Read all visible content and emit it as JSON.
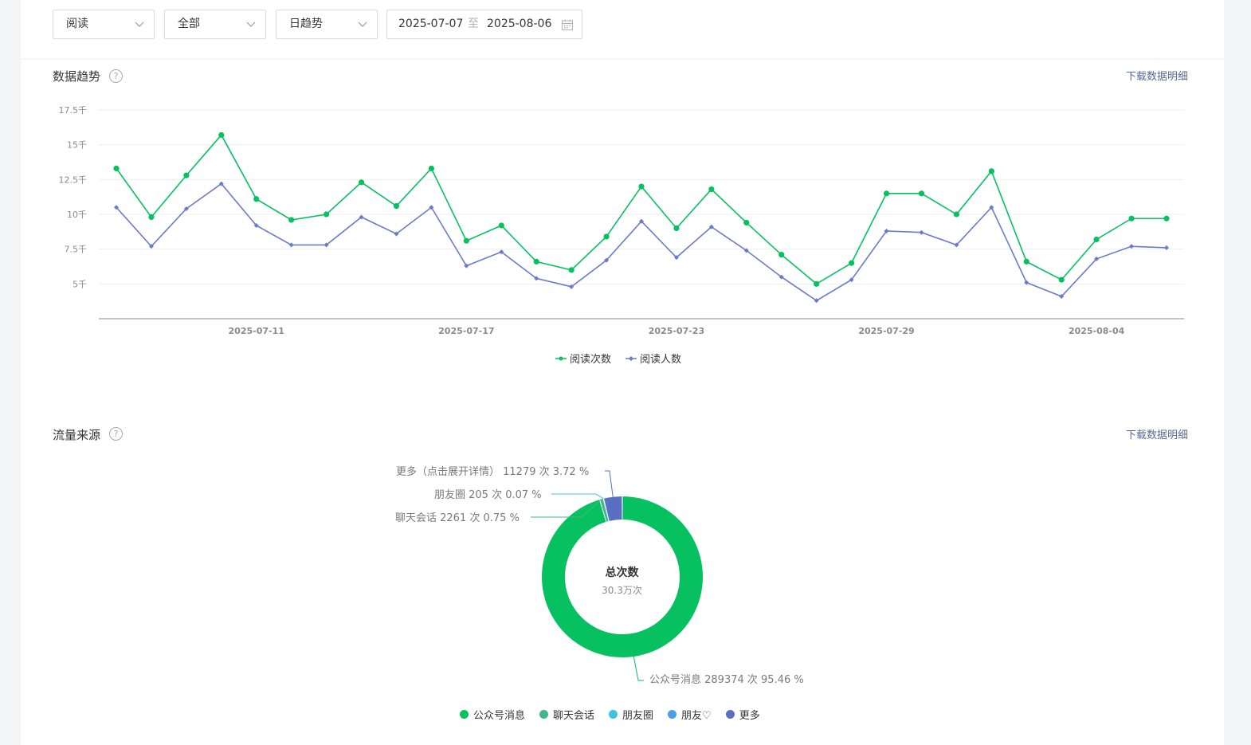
{
  "filters": {
    "type_select": "阅读",
    "scope_select": "全部",
    "period_select": "日趋势",
    "date_start": "2025-07-07",
    "date_sep": "至",
    "date_end": "2025-08-06"
  },
  "trend_section": {
    "title": "数据趋势",
    "help": "?",
    "download": "下载数据明细"
  },
  "traffic_section": {
    "title": "流量来源",
    "help": "?",
    "download": "下载数据明细",
    "center_title": "总次数",
    "center_value": "30.3万次"
  },
  "colors": {
    "green": "#07c160",
    "purple": "#6b7bc9",
    "teal": "#3fb68b",
    "cyan": "#3ec6d8",
    "blue": "#4c9ee6",
    "indigo": "#5a6fc4"
  },
  "chart_data": [
    {
      "type": "line",
      "ylim": [
        2500,
        17500
      ],
      "yticks": [
        5000,
        7500,
        10000,
        12500,
        15000,
        17500
      ],
      "ytick_labels": [
        "5千",
        "7.5千",
        "10千",
        "12.5千",
        "15千",
        "17.5千"
      ],
      "x": [
        "2025-07-07",
        "2025-07-08",
        "2025-07-09",
        "2025-07-10",
        "2025-07-11",
        "2025-07-12",
        "2025-07-13",
        "2025-07-14",
        "2025-07-15",
        "2025-07-16",
        "2025-07-17",
        "2025-07-18",
        "2025-07-19",
        "2025-07-20",
        "2025-07-21",
        "2025-07-22",
        "2025-07-23",
        "2025-07-24",
        "2025-07-25",
        "2025-07-26",
        "2025-07-27",
        "2025-07-28",
        "2025-07-29",
        "2025-07-30",
        "2025-07-31",
        "2025-08-01",
        "2025-08-02",
        "2025-08-03",
        "2025-08-04",
        "2025-08-05",
        "2025-08-06"
      ],
      "xtick_labels": [
        "2025-07-11",
        "2025-07-17",
        "2025-07-23",
        "2025-07-29",
        "2025-08-04"
      ],
      "legend_position": "bottom",
      "series": [
        {
          "name": "阅读次数",
          "color": "#07c160",
          "marker": "circle",
          "values": [
            13300,
            9800,
            12800,
            15700,
            11100,
            9600,
            10000,
            12300,
            10600,
            13300,
            8100,
            9200,
            6600,
            6000,
            8400,
            12000,
            9000,
            11800,
            9400,
            7100,
            5000,
            6500,
            11500,
            11500,
            10000,
            13100,
            6600,
            5300,
            8200,
            9700,
            9700
          ]
        },
        {
          "name": "阅读人数",
          "color": "#6b7bc9",
          "marker": "diamond",
          "values": [
            10500,
            7700,
            10400,
            12200,
            9200,
            7800,
            7800,
            9800,
            8600,
            10500,
            6300,
            7300,
            5400,
            4800,
            6700,
            9500,
            6900,
            9100,
            7400,
            5500,
            3800,
            5300,
            8800,
            8700,
            7800,
            10500,
            5100,
            4100,
            6800,
            7700,
            7600
          ]
        }
      ]
    },
    {
      "type": "pie",
      "slices": [
        {
          "name": "公众号消息",
          "value": 289374,
          "percent": 95.46,
          "color": "#07c160",
          "label": "公众号消息 289374 次 95.46 %"
        },
        {
          "name": "聊天会话",
          "value": 2261,
          "percent": 0.75,
          "color": "#3fb68b",
          "label": "聊天会话 2261 次 0.75 %"
        },
        {
          "name": "朋友圈",
          "value": 205,
          "percent": 0.07,
          "color": "#3ec6d8",
          "label": "朋友圈 205 次 0.07 %"
        },
        {
          "name": "朋友♡",
          "value": 0,
          "percent": 0,
          "color": "#4c9ee6"
        },
        {
          "name": "更多",
          "value": 11279,
          "percent": 3.72,
          "color": "#5a6fc4",
          "label": "更多（点击展开详情） 11279 次 3.72 %"
        }
      ],
      "legend_position": "bottom"
    }
  ]
}
